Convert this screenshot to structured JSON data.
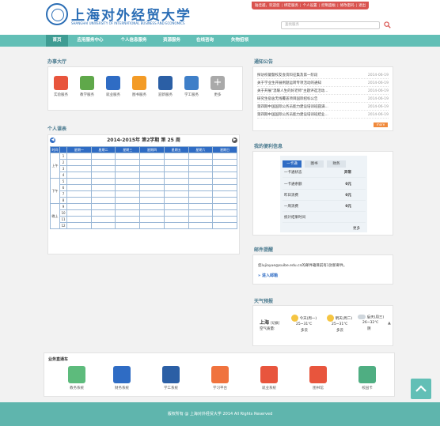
{
  "header": {
    "logo_cn": "上海对外经贸大学",
    "logo_en": "SHANGHAI UNIVERSITY OF INTERNATIONAL BUSINESS AND ECONOMICS",
    "top_links": [
      "陆佳越，欢迎您",
      "绑定服务",
      "个人设置",
      "控制面板",
      "修改密码",
      "退出"
    ],
    "search_placeholder": "查找服务"
  },
  "nav": {
    "items": [
      "首页",
      "应用服务中心",
      "个人信息服务",
      "资源服务",
      "在线咨询",
      "失物招领"
    ],
    "active_index": 0
  },
  "office": {
    "title": "办事大厅",
    "items": [
      {
        "label": "实验服务",
        "color": "#e8553d"
      },
      {
        "label": "教学服务",
        "color": "#5fa84a"
      },
      {
        "label": "就业服务",
        "color": "#2f6cc4"
      },
      {
        "label": "图书服务",
        "color": "#f39b26"
      },
      {
        "label": "迎新服务",
        "color": "#2b5fa5"
      },
      {
        "label": "学工服务",
        "color": "#3f7fc8"
      },
      {
        "label": "更多",
        "color": "#a9a9a9"
      }
    ]
  },
  "schedule": {
    "section_title": "个人课表",
    "title": "2014-2015年 第2学期 第 25 周",
    "columns": [
      "时间",
      "",
      "星期一",
      "星期二",
      "星期三",
      "星期四",
      "星期五",
      "星期六",
      "星期日"
    ],
    "periods": [
      "1",
      "2",
      "3",
      "4",
      "5",
      "6",
      "7",
      "8",
      "9",
      "10",
      "11",
      "12"
    ],
    "groups": [
      {
        "label": "上午",
        "rows": 4
      },
      {
        "label": "下午",
        "rows": 4
      },
      {
        "label": "晚上",
        "rows": 4
      }
    ]
  },
  "notices": {
    "title": "通知公告",
    "items": [
      {
        "text": "探访校徽暨校友会资料征集及第一阶段",
        "date": "2014-06-19"
      },
      {
        "text": "关于学业生开展例题运转专项活动的通知",
        "date": "2014-06-19"
      },
      {
        "text": "关于开展\"温暖人生的好老师\"主题评选活动...",
        "date": "2014-06-19"
      },
      {
        "text": "研究生宿舍无线覆盖项目国际招标公告",
        "date": "2014-06-19"
      },
      {
        "text": "第四期中国国际公务员能力建设培训班圆满...",
        "date": "2014-06-19"
      },
      {
        "text": "第四期中国国际公务员能力建设培训班结业...",
        "date": "2014-06-19"
      }
    ],
    "more": "more"
  },
  "info": {
    "title": "我的便利信息",
    "tabs": [
      "一卡通",
      "图书",
      "财务"
    ],
    "active_tab": 0,
    "rows": [
      {
        "label": "一卡通状态",
        "value": "异常"
      },
      {
        "label": "一卡通余额",
        "value": "0元"
      },
      {
        "label": "昨日消费",
        "value": "0元"
      },
      {
        "label": "一周消费",
        "value": "0元"
      },
      {
        "label": "统计结果时间",
        "value": ""
      }
    ],
    "more": "更多"
  },
  "mail": {
    "title": "邮件提醒",
    "text": "您lujiayue@suibe.edu.cn的邮件箱目前有1封新邮件。",
    "link": "进入邮箱"
  },
  "weather": {
    "title": "天气预报",
    "city": "上海",
    "city_tag": "[切换]",
    "air_label": "空气质量:",
    "days": [
      {
        "label": "今天(周一)",
        "temp": "25~31℃",
        "desc": "多云"
      },
      {
        "label": "明天(周二)",
        "temp": "25~31℃",
        "desc": "多云"
      },
      {
        "label": "后天(周三)",
        "temp": "26~32℃",
        "desc": "阴"
      }
    ]
  },
  "systems": {
    "title": "业务直通车",
    "items": [
      {
        "label": "教务系统",
        "color": "#5dbb7c"
      },
      {
        "label": "财务系统",
        "color": "#2f6cc4"
      },
      {
        "label": "学工系统",
        "color": "#2b5fa5"
      },
      {
        "label": "学习平台",
        "color": "#f0733e"
      },
      {
        "label": "就业系统",
        "color": "#e8553d"
      },
      {
        "label": "图书馆",
        "color": "#e8553d"
      },
      {
        "label": "校园卡",
        "color": "#4fae82"
      }
    ]
  },
  "footer": {
    "text": "版权所有 @ 上海对外经贸大学 2014 All Rights Reserved"
  }
}
